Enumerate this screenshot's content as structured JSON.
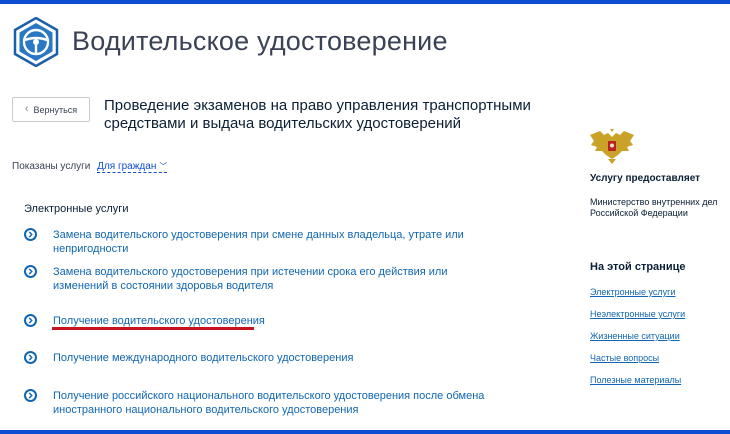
{
  "header": {
    "title": "Водительское удостоверение",
    "logo_icon": "steering-wheel-icon",
    "accent_color": "#0d4cd3"
  },
  "back_button": {
    "label": "Вернуться",
    "icon": "chevron-left-icon"
  },
  "service": {
    "title": "Проведение экзаменов на право управления транспортными средствами и выдача водительских удостоверений"
  },
  "filter": {
    "label": "Показаны услуги",
    "value": "Для граждан",
    "icon": "chevron-down-icon"
  },
  "electronic_services": {
    "heading": "Электронные услуги",
    "items": [
      {
        "label": "Замена водительского удостоверения при смене данных владельца, утрате или непригодности"
      },
      {
        "label": "Замена водительского удостоверения при истечении срока его действия или изменений в состоянии здоровья водителя"
      },
      {
        "label": "Получение водительского удостоверения"
      },
      {
        "label": "Получение международного водительского удостоверения"
      },
      {
        "label": "Получение российского национального водительского удостоверения после обмена иностранного национального водительского удостоверения"
      }
    ],
    "highlight_color": "#c4131f"
  },
  "sidebar": {
    "emblem_icon": "double-headed-eagle-icon",
    "provider_heading": "Услугу предоставляет",
    "provider_name": "Министерство внутренних дел Российской Федерации",
    "onpage_heading": "На этой странице",
    "onpage_links": [
      {
        "label": "Электронные услуги"
      },
      {
        "label": "Неэлектронные услуги"
      },
      {
        "label": "Жизненные ситуации"
      },
      {
        "label": "Частые вопросы"
      },
      {
        "label": "Полезные материалы"
      }
    ]
  }
}
